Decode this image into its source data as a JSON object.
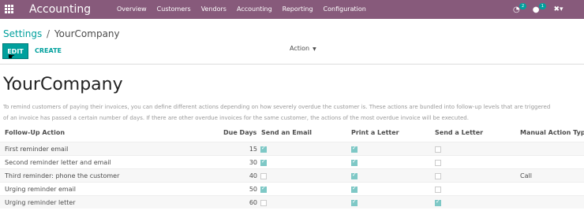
{
  "navbar": {
    "app_name": "Accounting",
    "menu": [
      "Overview",
      "Customers",
      "Vendors",
      "Accounting",
      "Reporting",
      "Configuration"
    ],
    "activity_badge": "2",
    "messages_badge": "1",
    "icons": [
      "apps-grid-icon",
      "activity-icon",
      "chat-icon",
      "tools-icon"
    ]
  },
  "control": {
    "breadcrumb_parent": "Settings",
    "breadcrumb_sep": "/",
    "breadcrumb_current": "YourCompany",
    "edit_label": "EDIT",
    "create_label": "CREATE",
    "action_label": "Action"
  },
  "form": {
    "title": "YourCompany",
    "description_line1": "To remind customers of paying their invoices, you can define different actions depending on how severely overdue the customer is. These actions are bundled into follow-up levels that are triggered",
    "description_line2": "of an invoice has passed a certain number of days. If there are other overdue invoices for the same customer, the actions of the most overdue invoice will be executed."
  },
  "table": {
    "headers": [
      "Follow-Up Action",
      "Due Days",
      "Send an Email",
      "Print a Letter",
      "Send a Letter",
      "Manual Action Type"
    ],
    "rows": [
      {
        "action": "First reminder email",
        "days": "15",
        "email": true,
        "print": true,
        "send": false,
        "manual": ""
      },
      {
        "action": "Second reminder letter and email",
        "days": "30",
        "email": true,
        "print": true,
        "send": false,
        "manual": ""
      },
      {
        "action": "Third reminder: phone the customer",
        "days": "40",
        "email": false,
        "print": true,
        "send": false,
        "manual": "Call"
      },
      {
        "action": "Urging reminder email",
        "days": "50",
        "email": true,
        "print": true,
        "send": false,
        "manual": ""
      },
      {
        "action": "Urging reminder letter",
        "days": "60",
        "email": false,
        "print": true,
        "send": true,
        "manual": ""
      }
    ]
  },
  "colors": {
    "navbar": "#875a7b",
    "accent": "#00a09d"
  }
}
